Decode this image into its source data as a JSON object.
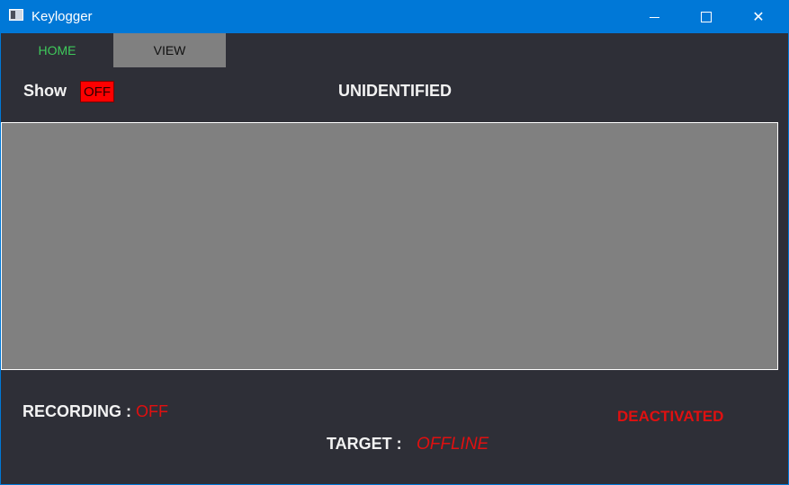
{
  "window": {
    "title": "Keylogger",
    "icons": {
      "app": "app-window-icon",
      "minimize": "minimize-icon",
      "maximize": "maximize-icon",
      "close": "close-icon"
    },
    "close_glyph": "✕"
  },
  "tabs": [
    {
      "label": "HOME",
      "active": true,
      "color": "#3fc95b"
    },
    {
      "label": "VIEW",
      "active": false,
      "color": "#808080"
    }
  ],
  "show": {
    "label": "Show",
    "toggle_value": "OFF",
    "toggle_color": "#ff0000"
  },
  "status_title": "UNIDENTIFIED",
  "log_area": {
    "content": ""
  },
  "recording": {
    "label": "RECORDING :",
    "value": "OFF"
  },
  "activation_status": "DEACTIVATED",
  "target": {
    "label": "TARGET :",
    "value": "OFFLINE"
  },
  "colors": {
    "titlebar": "#0078d7",
    "background": "#2e2f37",
    "panel": "#808080",
    "alert": "#e01010"
  }
}
